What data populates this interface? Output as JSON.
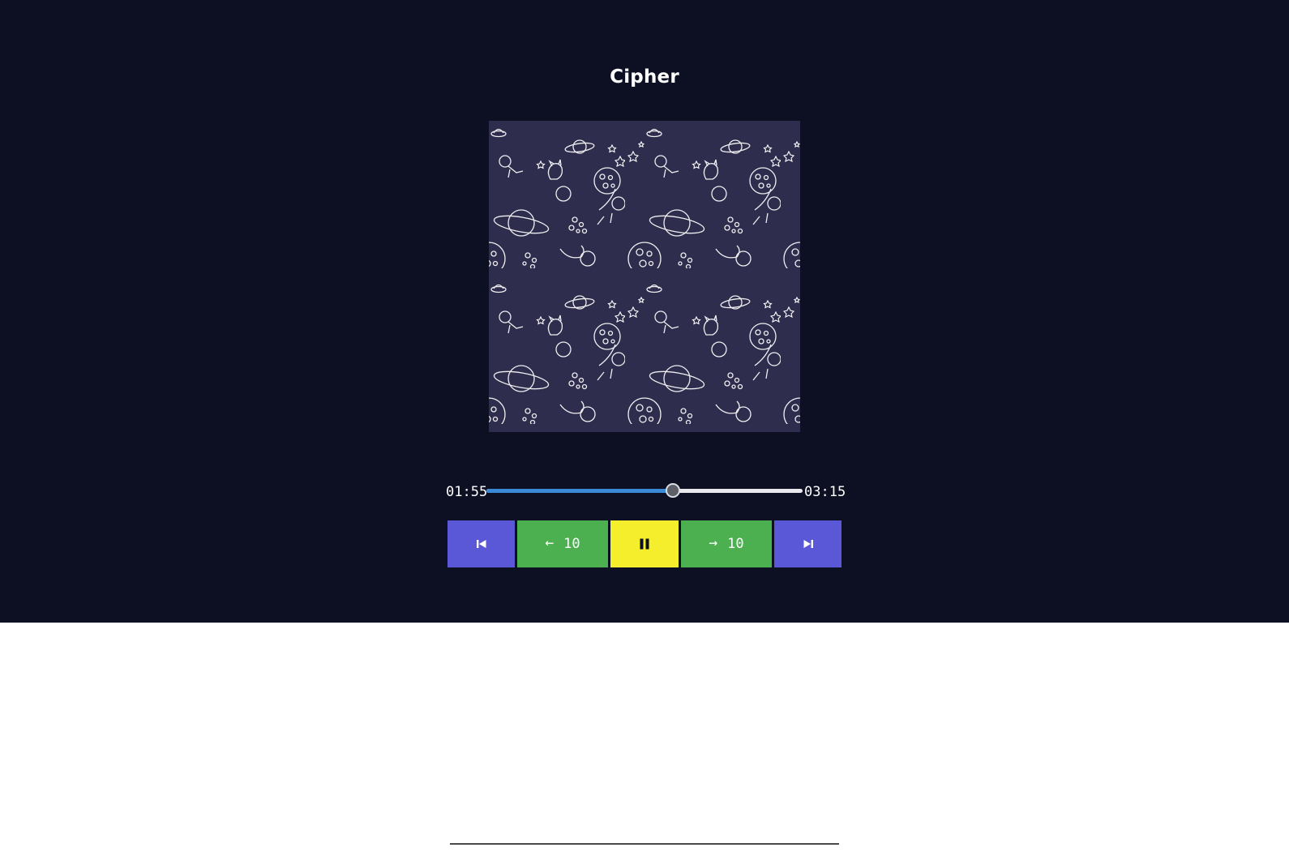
{
  "track": {
    "title": "Cipher"
  },
  "cover_art": {
    "description_icon": "space-doodle-pattern-icon"
  },
  "progress": {
    "current_time": "01:55",
    "total_time": "03:15",
    "fraction": 0.59
  },
  "controls": {
    "previous_icon": "skip-previous-icon",
    "rewind_arrow": "←",
    "rewind_seconds": "10",
    "pause_icon": "pause-icon",
    "forward_arrow": "→",
    "forward_seconds": "10",
    "next_icon": "skip-next-icon"
  },
  "colors": {
    "panel_background": "#0d1023",
    "cover_background": "#2f2d4d",
    "seek_fill": "#3b8ad6",
    "seek_track": "#e9e9ee",
    "skip_buttons": "#5a58d6",
    "jump_buttons": "#4caf50",
    "play_button": "#f4ee2d"
  }
}
